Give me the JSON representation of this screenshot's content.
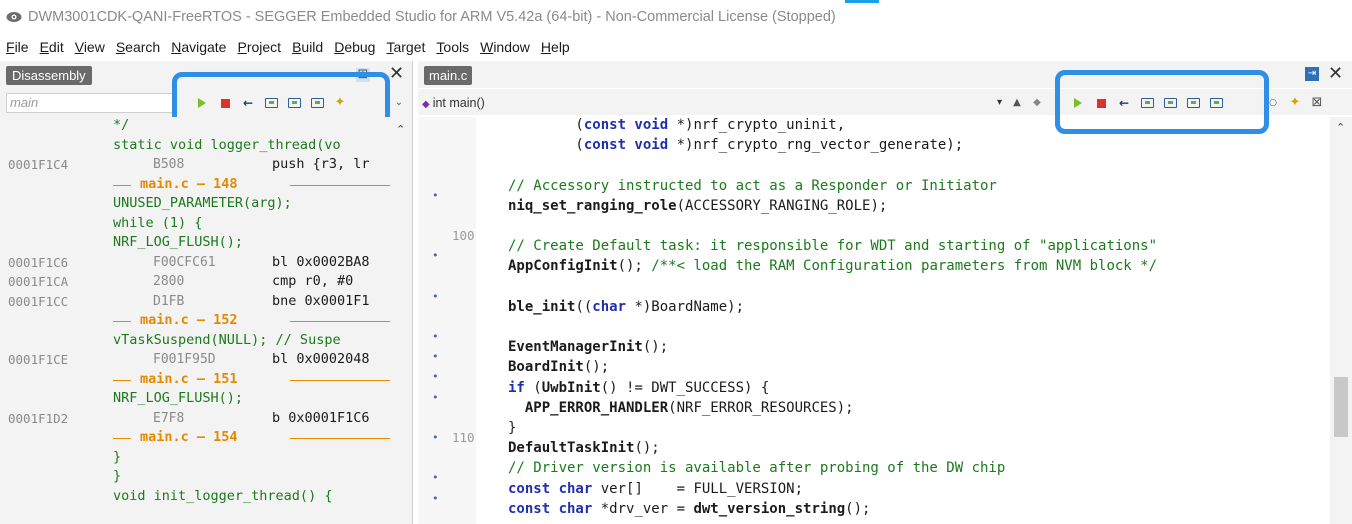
{
  "window": {
    "title": "DWM3001CDK-QANI-FreeRTOS - SEGGER Embedded Studio for ARM V5.42a (64-bit) - Non-Commercial License (Stopped)"
  },
  "menu": [
    {
      "label": "File",
      "ul": "F"
    },
    {
      "label": "Edit",
      "ul": "E"
    },
    {
      "label": "View",
      "ul": "V"
    },
    {
      "label": "Search",
      "ul": "S"
    },
    {
      "label": "Navigate",
      "ul": "N"
    },
    {
      "label": "Project",
      "ul": "P"
    },
    {
      "label": "Build",
      "ul": "B"
    },
    {
      "label": "Debug",
      "ul": "D"
    },
    {
      "label": "Target",
      "ul": "T"
    },
    {
      "label": "Tools",
      "ul": "T"
    },
    {
      "label": "Window",
      "ul": "W"
    },
    {
      "label": "Help",
      "ul": "H"
    }
  ],
  "disassembly": {
    "tab_label": "Disassembly",
    "location_placeholder": "main",
    "lines": [
      {
        "kind": "src",
        "text": "*/"
      },
      {
        "kind": "src",
        "text": "static void logger_thread(vo"
      },
      {
        "kind": "asm",
        "addr": "0001F1C4",
        "opcode": "B508",
        "instr": "push {r3, lr"
      },
      {
        "kind": "sep",
        "text": "main.c — 148"
      },
      {
        "kind": "src",
        "text": "UNUSED_PARAMETER(arg);"
      },
      {
        "kind": "src",
        "text": "while (1) {"
      },
      {
        "kind": "src",
        "text": "NRF_LOG_FLUSH();"
      },
      {
        "kind": "asm",
        "addr": "0001F1C6",
        "opcode": "F00CFC61",
        "instr": "bl 0x0002BA8"
      },
      {
        "kind": "asm",
        "addr": "0001F1CA",
        "opcode": "2800",
        "instr": "cmp r0, #0"
      },
      {
        "kind": "asm",
        "addr": "0001F1CC",
        "opcode": "D1FB",
        "instr": "bne 0x0001F1"
      },
      {
        "kind": "sep",
        "text": "main.c — 152"
      },
      {
        "kind": "src",
        "text": "vTaskSuspend(NULL); // Suspe"
      },
      {
        "kind": "asm",
        "addr": "0001F1CE",
        "opcode": "F001F95D",
        "instr": "bl 0x0002048"
      },
      {
        "kind": "sep",
        "text": "main.c — 151"
      },
      {
        "kind": "src",
        "text": "NRF_LOG_FLUSH();"
      },
      {
        "kind": "asm",
        "addr": "0001F1D2",
        "opcode": "E7F8",
        "instr": "b 0x0001F1C6"
      },
      {
        "kind": "sep",
        "text": "main.c — 154"
      },
      {
        "kind": "src",
        "text": "}"
      },
      {
        "kind": "src",
        "text": "}"
      },
      {
        "kind": "src",
        "text": "void init_logger_thread() {"
      }
    ]
  },
  "editor": {
    "tab_label": "main.c",
    "function_combo": "int main()",
    "gutter": [
      {
        "dot": false,
        "num": ""
      },
      {
        "dot": false,
        "num": ""
      },
      {
        "dot": false,
        "num": ""
      },
      {
        "dot": true,
        "num": ""
      },
      {
        "dot": false,
        "num": ""
      },
      {
        "dot": false,
        "num": "100"
      },
      {
        "dot": true,
        "num": ""
      },
      {
        "dot": false,
        "num": ""
      },
      {
        "dot": true,
        "num": ""
      },
      {
        "dot": false,
        "num": ""
      },
      {
        "dot": true,
        "num": ""
      },
      {
        "dot": true,
        "num": ""
      },
      {
        "dot": true,
        "num": ""
      },
      {
        "dot": true,
        "num": ""
      },
      {
        "dot": false,
        "num": ""
      },
      {
        "dot": true,
        "num": "110"
      },
      {
        "dot": false,
        "num": ""
      },
      {
        "dot": true,
        "num": ""
      },
      {
        "dot": true,
        "num": ""
      }
    ],
    "code": [
      [
        {
          "c": "plain",
          "t": "        ("
        },
        {
          "c": "kw",
          "t": "const void"
        },
        {
          "c": "plain",
          "t": " *)nrf_crypto_uninit,"
        }
      ],
      [
        {
          "c": "plain",
          "t": "        ("
        },
        {
          "c": "kw",
          "t": "const void"
        },
        {
          "c": "plain",
          "t": " *)nrf_crypto_rng_vector_generate);"
        }
      ],
      [
        {
          "c": "plain",
          "t": ""
        }
      ],
      [
        {
          "c": "cm",
          "t": "// Accessory instructed to act as a Responder or Initiator"
        }
      ],
      [
        {
          "c": "fn",
          "t": "niq_set_ranging_role"
        },
        {
          "c": "plain",
          "t": "(ACCESSORY_RANGING_ROLE);"
        }
      ],
      [
        {
          "c": "plain",
          "t": ""
        }
      ],
      [
        {
          "c": "cm",
          "t": "// Create Default task: it responsible for WDT and starting of \"applications\""
        }
      ],
      [
        {
          "c": "fn",
          "t": "AppConfigInit"
        },
        {
          "c": "plain",
          "t": "(); "
        },
        {
          "c": "cm",
          "t": "/**< load the RAM Configuration parameters from NVM block */"
        }
      ],
      [
        {
          "c": "plain",
          "t": ""
        }
      ],
      [
        {
          "c": "fn",
          "t": "ble_init"
        },
        {
          "c": "plain",
          "t": "(("
        },
        {
          "c": "kw",
          "t": "char"
        },
        {
          "c": "plain",
          "t": " *)BoardName);"
        }
      ],
      [
        {
          "c": "plain",
          "t": ""
        }
      ],
      [
        {
          "c": "fn",
          "t": "EventManagerInit"
        },
        {
          "c": "plain",
          "t": "();"
        }
      ],
      [
        {
          "c": "fn",
          "t": "BoardInit"
        },
        {
          "c": "plain",
          "t": "();"
        }
      ],
      [
        {
          "c": "kw",
          "t": "if"
        },
        {
          "c": "plain",
          "t": " ("
        },
        {
          "c": "fn",
          "t": "UwbInit"
        },
        {
          "c": "plain",
          "t": "() != DWT_SUCCESS) {"
        }
      ],
      [
        {
          "c": "plain",
          "t": "  "
        },
        {
          "c": "fn",
          "t": "APP_ERROR_HANDLER"
        },
        {
          "c": "plain",
          "t": "(NRF_ERROR_RESOURCES);"
        }
      ],
      [
        {
          "c": "plain",
          "t": "}"
        }
      ],
      [
        {
          "c": "fn",
          "t": "DefaultTaskInit"
        },
        {
          "c": "plain",
          "t": "();"
        }
      ],
      [
        {
          "c": "cm",
          "t": "// Driver version is available after probing of the DW chip"
        }
      ],
      [
        {
          "c": "kw",
          "t": "const char"
        },
        {
          "c": "plain",
          "t": " ver[]    = FULL_VERSION;"
        }
      ],
      [
        {
          "c": "kw",
          "t": "const char"
        },
        {
          "c": "plain",
          "t": " *drv_ver = "
        },
        {
          "c": "fn",
          "t": "dwt_version_string"
        },
        {
          "c": "plain",
          "t": "();"
        }
      ]
    ]
  }
}
